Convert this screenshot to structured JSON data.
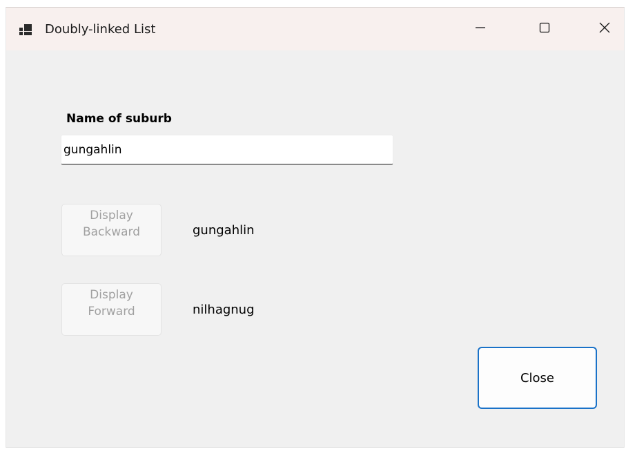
{
  "window": {
    "title": "Doubly-linked List",
    "icon": "app-window-icon"
  },
  "titlebar": {
    "minimize_icon": "minimize-icon",
    "maximize_icon": "maximize-icon",
    "close_icon": "close-icon"
  },
  "form": {
    "suburb_label": "Name of suburb",
    "suburb_value": "gungahlin",
    "backward_button": {
      "line1": "Display",
      "line2": "Backward",
      "enabled": false
    },
    "backward_output": "gungahlin",
    "forward_button": {
      "line1": "Display",
      "line2": "Forward",
      "enabled": false
    },
    "forward_output": "nilhagnug",
    "close_label": "Close"
  },
  "colors": {
    "accent": "#1a72c8",
    "titlebar_bg": "#f8f0ee",
    "window_bg": "#f0f0f0",
    "disabled_text": "#a0a0a0"
  }
}
